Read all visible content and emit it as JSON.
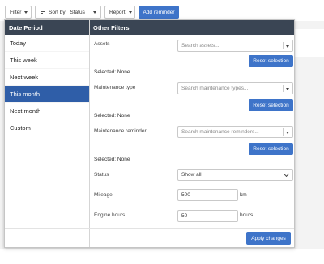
{
  "toolbar": {
    "filter_label": "Filter",
    "sort_label": "Sort by:",
    "sort_value": "Status",
    "report_label": "Report",
    "add_reminder_label": "Add reminder"
  },
  "date_period": {
    "heading": "Date Period",
    "items": [
      "Today",
      "This week",
      "Next week",
      "This month",
      "Next month",
      "Custom"
    ],
    "selected": "This month"
  },
  "other_filters": {
    "heading": "Other Filters",
    "assets": {
      "label": "Assets",
      "placeholder": "Search assets...",
      "reset_label": "Reset selection",
      "selected_text": "Selected: None"
    },
    "maintenance_type": {
      "label": "Maintenance type",
      "placeholder": "Search maintenance types...",
      "reset_label": "Reset selection",
      "selected_text": "Selected: None"
    },
    "maintenance_reminder": {
      "label": "Maintenance reminder",
      "placeholder": "Search maintenance reminders...",
      "reset_label": "Reset selection",
      "selected_text": "Selected: None"
    },
    "status": {
      "label": "Status",
      "value": "Show all"
    },
    "mileage": {
      "label": "Mileage",
      "value": "500",
      "unit": "km"
    },
    "engine_hours": {
      "label": "Engine hours",
      "value": "50",
      "unit": "hours"
    },
    "apply_label": "Apply changes"
  },
  "icons": {
    "sort": "sort-lines-icon",
    "dropdown": "caret-down-icon",
    "select": "chevron-down-icon"
  },
  "colors": {
    "primary": "#3e74c9",
    "header_dark": "#3a4554",
    "active_period": "#2f5ea8"
  }
}
